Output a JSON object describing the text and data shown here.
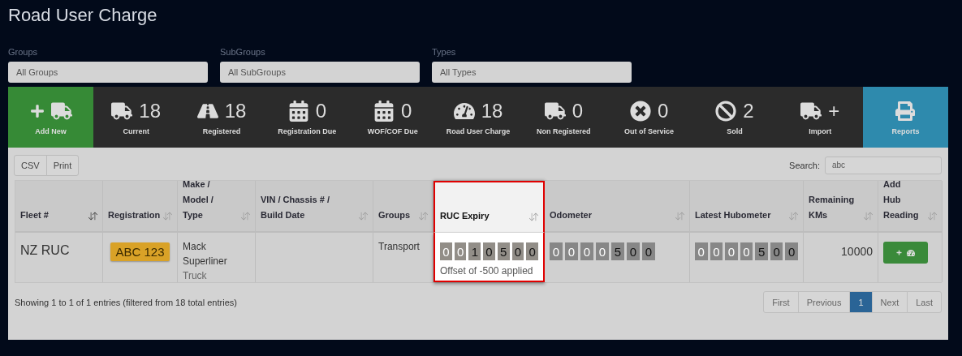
{
  "title": "Road User Charge",
  "filters": [
    {
      "label": "Groups",
      "value": "All Groups"
    },
    {
      "label": "SubGroups",
      "value": "All SubGroups"
    },
    {
      "label": "Types",
      "value": "All Types"
    }
  ],
  "stats": [
    {
      "kind": "add",
      "label": "Add New"
    },
    {
      "kind": "stat",
      "count": "18",
      "label": "Current"
    },
    {
      "kind": "stat",
      "count": "18",
      "label": "Registered"
    },
    {
      "kind": "stat",
      "count": "0",
      "label": "Registration Due"
    },
    {
      "kind": "stat",
      "count": "0",
      "label": "WOF/COF Due"
    },
    {
      "kind": "stat",
      "count": "18",
      "label": "Road User Charge"
    },
    {
      "kind": "stat",
      "count": "0",
      "label": "Non Registered"
    },
    {
      "kind": "stat",
      "count": "0",
      "label": "Out of Service"
    },
    {
      "kind": "stat",
      "count": "2",
      "label": "Sold"
    },
    {
      "kind": "stat",
      "count": "+",
      "label": "Import"
    },
    {
      "kind": "report",
      "label": "Reports"
    }
  ],
  "export_buttons": [
    "CSV",
    "Print"
  ],
  "search": {
    "label": "Search:",
    "value": "abc"
  },
  "table": {
    "columns": [
      {
        "lines": [
          "Fleet #"
        ],
        "sorted": true,
        "highlighted": false
      },
      {
        "lines": [
          "Registration"
        ],
        "sorted": false,
        "highlighted": false
      },
      {
        "lines": [
          "Make /",
          "Model /",
          "Type"
        ],
        "sorted": false,
        "highlighted": false
      },
      {
        "lines": [
          "VIN / Chassis # /",
          "Build Date"
        ],
        "sorted": false,
        "highlighted": false
      },
      {
        "lines": [
          "Groups"
        ],
        "sorted": false,
        "highlighted": false
      },
      {
        "lines": [
          "RUC Expiry"
        ],
        "sorted": false,
        "highlighted": true
      },
      {
        "lines": [
          "Odometer"
        ],
        "sorted": false,
        "highlighted": false
      },
      {
        "lines": [
          "Latest Hubometer"
        ],
        "sorted": false,
        "highlighted": false
      },
      {
        "lines": [
          "Remaining",
          "KMs"
        ],
        "sorted": false,
        "highlighted": false
      },
      {
        "lines": [
          "Add",
          "Hub",
          "Reading"
        ],
        "sorted": false,
        "highlighted": false
      }
    ],
    "rows": [
      {
        "fleet": "NZ RUC",
        "registration": "ABC 123",
        "make": "Mack",
        "model": "Superliner",
        "type": "Truck",
        "groups": "Transport",
        "ruc_expiry": {
          "digits": [
            {
              "value": "0",
              "lead": true
            },
            {
              "value": "0",
              "lead": true
            },
            {
              "value": "1",
              "lead": false
            },
            {
              "value": "0",
              "lead": false
            },
            {
              "value": "5",
              "lead": false
            },
            {
              "value": "0",
              "lead": false
            },
            {
              "value": "0",
              "lead": false
            }
          ],
          "note": "Offset of -500 applied"
        },
        "odometer": [
          {
            "value": "0",
            "lead": true
          },
          {
            "value": "0",
            "lead": true
          },
          {
            "value": "0",
            "lead": true
          },
          {
            "value": "0",
            "lead": true
          },
          {
            "value": "5",
            "lead": false
          },
          {
            "value": "0",
            "lead": false
          },
          {
            "value": "0",
            "lead": false
          }
        ],
        "hubometer": [
          {
            "value": "0",
            "lead": true
          },
          {
            "value": "0",
            "lead": true
          },
          {
            "value": "0",
            "lead": true
          },
          {
            "value": "0",
            "lead": true
          },
          {
            "value": "5",
            "lead": false
          },
          {
            "value": "0",
            "lead": false
          },
          {
            "value": "0",
            "lead": false
          }
        ],
        "remaining_kms": "10000"
      }
    ]
  },
  "info": "Showing 1 to 1 of 1 entries (filtered from 18 total entries)",
  "pagination": [
    {
      "label": "First",
      "selected": false
    },
    {
      "label": "Previous",
      "selected": false
    },
    {
      "label": "1",
      "selected": true
    },
    {
      "label": "Next",
      "selected": false
    },
    {
      "label": "Last",
      "selected": false
    }
  ]
}
